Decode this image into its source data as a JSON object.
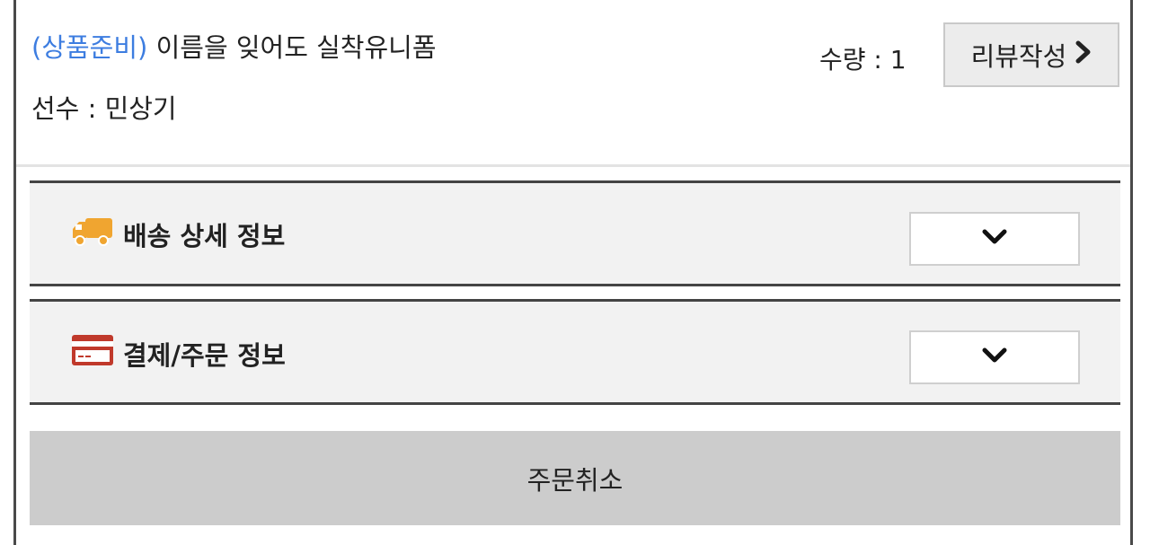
{
  "item": {
    "status": "(상품준비)",
    "name": "이름을 잊어도 실착유니폼",
    "player": "선수 : 민상기",
    "quantity": "수량 : 1"
  },
  "review_button": {
    "label": "리뷰작성",
    "icon": "chevron-right-icon"
  },
  "sections": [
    {
      "title": "배송 상세 정보",
      "icon": "truck-icon",
      "icon_color": "#f0a530"
    },
    {
      "title": "결제/주문 정보",
      "icon": "credit-card-icon",
      "icon_color": "#c0392b"
    }
  ],
  "cancel_button": {
    "label": "주문취소"
  }
}
